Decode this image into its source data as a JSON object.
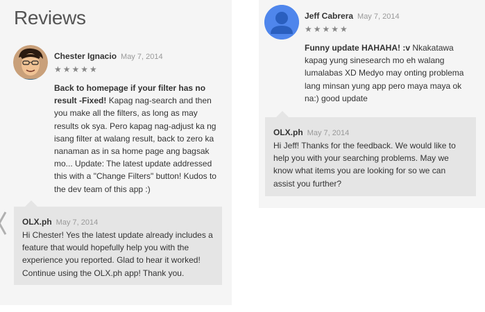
{
  "section_title": "Reviews",
  "colors": {
    "panel_bg": "#f5f5f5",
    "reply_bg": "#e5e5e5",
    "avatar_blue": "#4f86ec"
  },
  "reviews": [
    {
      "author": "Chester Ignacio",
      "date": "May 7, 2014",
      "rating": 5,
      "stars": "★★★★★",
      "avatar_icon": "cartoon-face-avatar",
      "title": "Back to homepage if your filter has no result -Fixed!",
      "text": "Kapag nag-search and then you make all the filters, as long as may results ok sya. Pero kapag nag-adjust ka ng isang filter at walang result, back to zero ka nanaman as in sa home page ang bagsak mo... Update: The latest update addressed this with a \"Change Filters\" button! Kudos to the dev team of this app :)",
      "reply": {
        "author": "OLX.ph",
        "date": "May 7, 2014",
        "text": "Hi Chester! Yes the latest update already includes a feature that would hopefully help you with the experience you reported. Glad to hear it worked! Continue using the OLX.ph app! Thank you."
      }
    },
    {
      "author": "Jeff Cabrera",
      "date": "May 7, 2014",
      "rating": 5,
      "stars": "★★★★★",
      "avatar_icon": "default-person-avatar",
      "title": "Funny update HAHAHA! :v",
      "text": "Nkakatawa kapag yung sinesearch mo eh walang lumalabas XD Medyo may onting problema lang minsan yung app pero maya maya ok na:) good update",
      "reply": {
        "author": "OLX.ph",
        "date": "May 7, 2014",
        "text": "Hi Jeff! Thanks for the feedback. We would like to help you with your searching problems. May we know what items you are looking for so we can assist you further?"
      }
    }
  ]
}
